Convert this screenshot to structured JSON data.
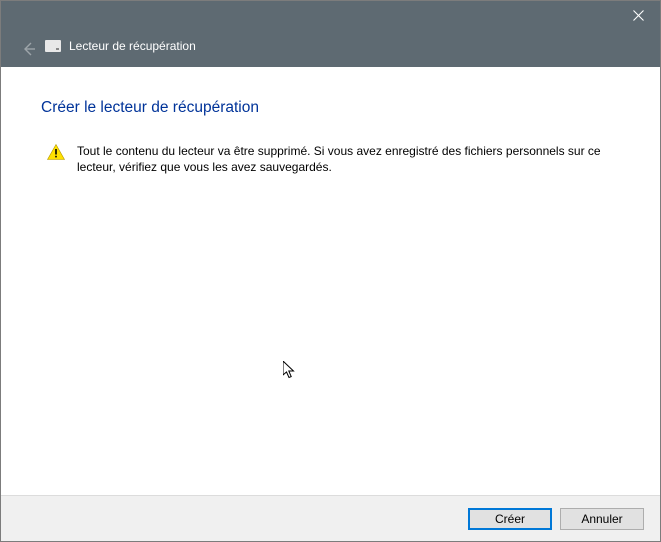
{
  "titlebar": {
    "app_title": "Lecteur de récupération"
  },
  "page": {
    "heading": "Créer le lecteur de récupération",
    "warning_text": "Tout le contenu du lecteur va être supprimé. Si vous avez enregistré des fichiers personnels sur ce lecteur, vérifiez que vous les avez sauvegardés."
  },
  "footer": {
    "create_label": "Créer",
    "cancel_label": "Annuler"
  }
}
